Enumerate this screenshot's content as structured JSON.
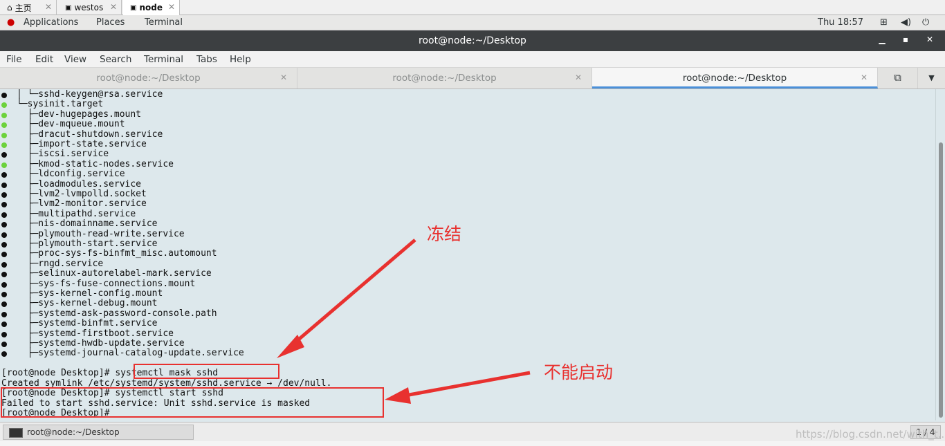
{
  "host_tabs": [
    {
      "label": "主页",
      "icon": "home-icon"
    },
    {
      "label": "westos",
      "icon": "vm-icon"
    },
    {
      "label": "node",
      "icon": "vm-icon"
    }
  ],
  "gnome": {
    "applications": "Applications",
    "places": "Places",
    "terminal": "Terminal",
    "clock": "Thu 18:57"
  },
  "window": {
    "title": "root@node:~/Desktop"
  },
  "menu": [
    "File",
    "Edit",
    "View",
    "Search",
    "Terminal",
    "Tabs",
    "Help"
  ],
  "tabs": [
    {
      "label": "root@node:~/Desktop"
    },
    {
      "label": "root@node:~/Desktop"
    },
    {
      "label": "root@node:~/Desktop"
    }
  ],
  "tree_lines": [
    {
      "bullet": "#111111",
      "text": "│ └─sshd-keygen@rsa.service"
    },
    {
      "bullet": "#6cd23c",
      "text": "└─sysinit.target"
    },
    {
      "bullet": "#6cd23c",
      "text": "  ├─dev-hugepages.mount"
    },
    {
      "bullet": "#6cd23c",
      "text": "  ├─dev-mqueue.mount"
    },
    {
      "bullet": "#6cd23c",
      "text": "  ├─dracut-shutdown.service"
    },
    {
      "bullet": "#6cd23c",
      "text": "  ├─import-state.service"
    },
    {
      "bullet": "#111111",
      "text": "  ├─iscsi.service"
    },
    {
      "bullet": "#6cd23c",
      "text": "  ├─kmod-static-nodes.service"
    },
    {
      "bullet": "#111111",
      "text": "  ├─ldconfig.service"
    },
    {
      "bullet": "#111111",
      "text": "  ├─loadmodules.service"
    },
    {
      "bullet": "#111111",
      "text": "  ├─lvm2-lvmpolld.socket"
    },
    {
      "bullet": "#111111",
      "text": "  ├─lvm2-monitor.service"
    },
    {
      "bullet": "#111111",
      "text": "  ├─multipathd.service"
    },
    {
      "bullet": "#111111",
      "text": "  ├─nis-domainname.service"
    },
    {
      "bullet": "#111111",
      "text": "  ├─plymouth-read-write.service"
    },
    {
      "bullet": "#111111",
      "text": "  ├─plymouth-start.service"
    },
    {
      "bullet": "#111111",
      "text": "  ├─proc-sys-fs-binfmt_misc.automount"
    },
    {
      "bullet": "#111111",
      "text": "  ├─rngd.service"
    },
    {
      "bullet": "#111111",
      "text": "  ├─selinux-autorelabel-mark.service"
    },
    {
      "bullet": "#111111",
      "text": "  ├─sys-fs-fuse-connections.mount"
    },
    {
      "bullet": "#111111",
      "text": "  ├─sys-kernel-config.mount"
    },
    {
      "bullet": "#111111",
      "text": "  ├─sys-kernel-debug.mount"
    },
    {
      "bullet": "#111111",
      "text": "  ├─systemd-ask-password-console.path"
    },
    {
      "bullet": "#111111",
      "text": "  ├─systemd-binfmt.service"
    },
    {
      "bullet": "#111111",
      "text": "  ├─systemd-firstboot.service"
    },
    {
      "bullet": "#111111",
      "text": "  ├─systemd-hwdb-update.service"
    },
    {
      "bullet": "#111111",
      "text": "  ├─systemd-journal-catalog-update.service"
    }
  ],
  "commands": [
    "[root@node Desktop]# systemctl mask sshd",
    "Created symlink /etc/systemd/system/sshd.service → /dev/null.",
    "[root@node Desktop]# systemctl start sshd",
    "Failed to start sshd.service: Unit sshd.service is masked",
    "[root@node Desktop]#"
  ],
  "annotations": {
    "freeze": "冻结",
    "cannot_start": "不能启动"
  },
  "taskbar": {
    "item": "root@node:~/Desktop",
    "pager": "1 / 4"
  },
  "watermark": "https://blog.csdn.net/with_t...",
  "colors": {
    "accent": "#4a90d9",
    "annotation": "#e8312f",
    "terminal_bg": "#dde8ec"
  }
}
